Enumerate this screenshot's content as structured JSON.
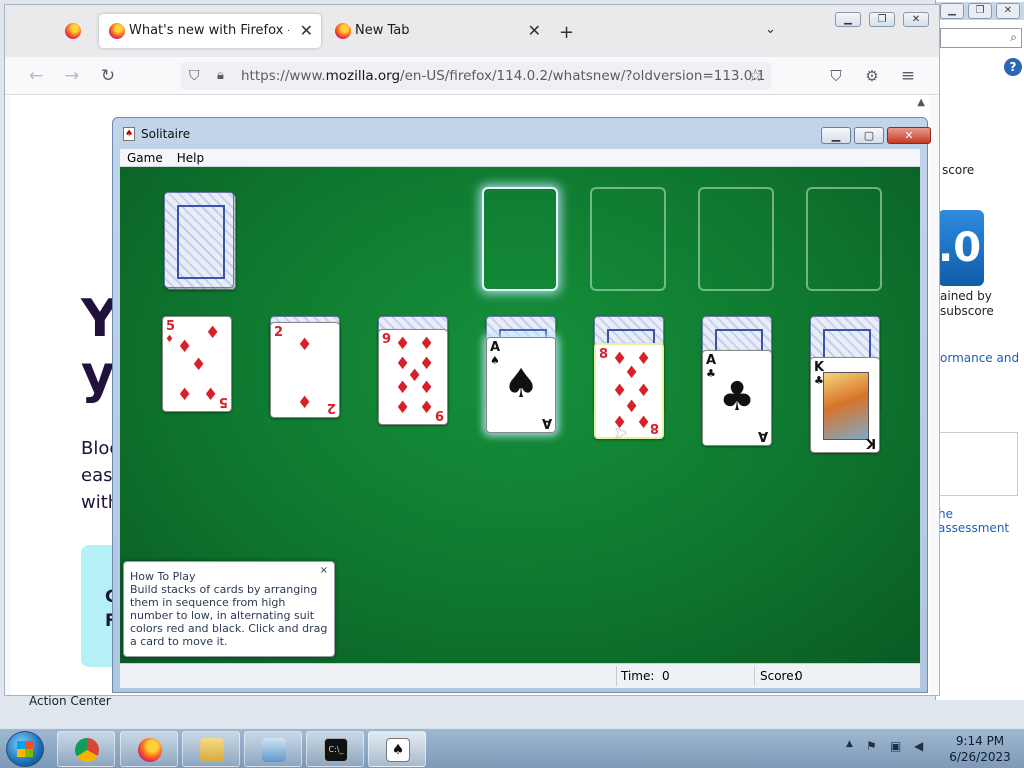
{
  "firefox": {
    "tabs": [
      {
        "label": "What's new with Firefox - More",
        "active": true
      },
      {
        "label": "New Tab",
        "active": false
      }
    ],
    "url_prefix": "https://www.",
    "url_domain": "mozilla.org",
    "url_rest": "/en-US/firefox/114.0.2/whatsnew/?oldversion=113.0.1",
    "page": {
      "headline_line1": "Yo",
      "headline_line2": "yo",
      "para_line1": "Bloc",
      "para_line2": "easi",
      "para_line3": "with",
      "cta_line1": "G",
      "cta_line2": "F"
    },
    "side": {
      "score_text": "score",
      "badge_text": ".0",
      "caption_line1": "ained by",
      "caption_line2": "subscore",
      "link1": "ormance and",
      "link2": "he assessment"
    }
  },
  "solitaire": {
    "title": "Solitaire",
    "menu": [
      "Game",
      "Help"
    ],
    "cards": {
      "t1_rank": "5",
      "t2_rank": "2",
      "t3_rank": "9",
      "t4_rank": "A",
      "t5_rank": "8",
      "t6_rank": "A",
      "t7_rank": "K",
      "suit_diamond": "♦",
      "suit_spade": "♠",
      "suit_club": "♣"
    },
    "tip": {
      "title": "How To Play",
      "body": "Build stacks of cards by arranging them in sequence from high number to low, in alternating suit colors red and black. Click and drag a card to move it.",
      "close": "×"
    },
    "status": {
      "time_label": "Time:",
      "time_value": "0",
      "score_label": "Score:",
      "score_value": "0"
    }
  },
  "desktop": {
    "action_center": "Action Center"
  },
  "taskbar": {
    "time": "9:14 PM",
    "date": "6/26/2023",
    "pinned": [
      "chrome-icon",
      "firefox-icon",
      "explorer-icon",
      "control-panel-icon",
      "cmd-icon",
      "solitaire-icon"
    ]
  }
}
